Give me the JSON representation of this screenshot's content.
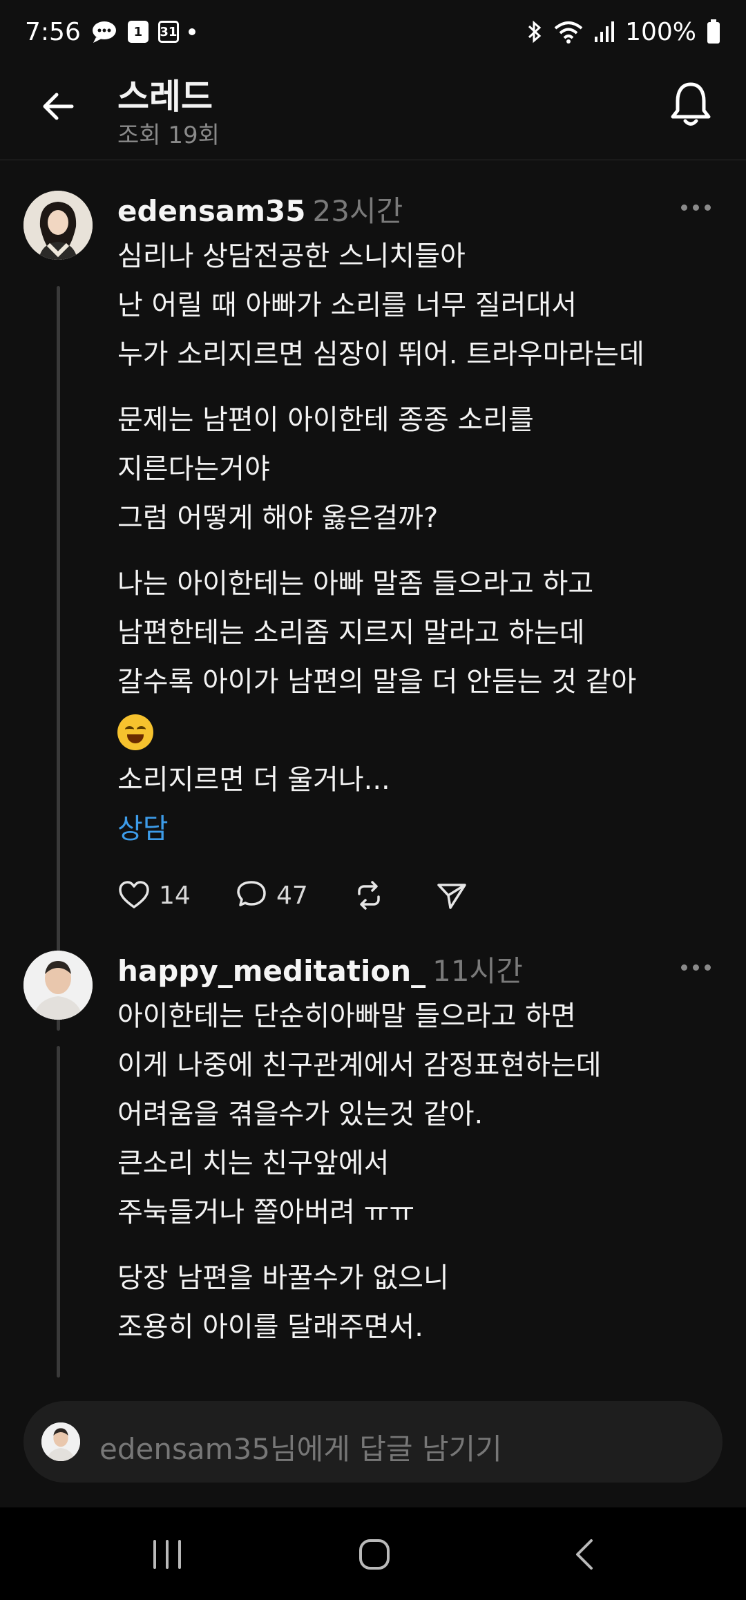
{
  "status_bar": {
    "time": "7:56",
    "calendar_day": "1",
    "date_badge": "31",
    "battery": "100%"
  },
  "header": {
    "title": "스레드",
    "views": "조회 19회"
  },
  "posts": [
    {
      "username": "edensam35",
      "time": "23시간",
      "lines": [
        "심리나 상담전공한 스니치들아",
        "난 어릴 때 아빠가 소리를 너무 질러대서",
        "누가 소리지르면 심장이 뛰어. 트라우마라는데",
        "",
        "문제는 남편이 아이한테 종종 소리를",
        "지른다는거야",
        "그럼 어떻게 해야 옳은걸까?",
        "",
        "나는 아이한테는 아빠 말좀 들으라고 하고",
        "남편한테는 소리좀 지르지 말라고 하는데",
        "갈수록 아이가 남편의 말을 더 안듣는 것 같아",
        "소리지르면 더 울거나..."
      ],
      "emoji": "laughing-with-tears",
      "tag": "상담",
      "likes": "14",
      "comments": "47"
    },
    {
      "username": "happy_meditation_",
      "time": "11시간",
      "lines": [
        "아이한테는 단순히아빠말 들으라고 하면",
        "이게 나중에 친구관계에서 감정표현하는데",
        "어려움을 겪을수가 있는것 같아.",
        "큰소리 치는 친구앞에서",
        "주눅들거나 쫄아버려 ㅠㅠ",
        "",
        "당장 남편을 바꿀수가 없으니",
        "조용히 아이를 달래주면서."
      ]
    }
  ],
  "reply_bar": {
    "placeholder": "edensam35님에게 답글 남기기"
  }
}
